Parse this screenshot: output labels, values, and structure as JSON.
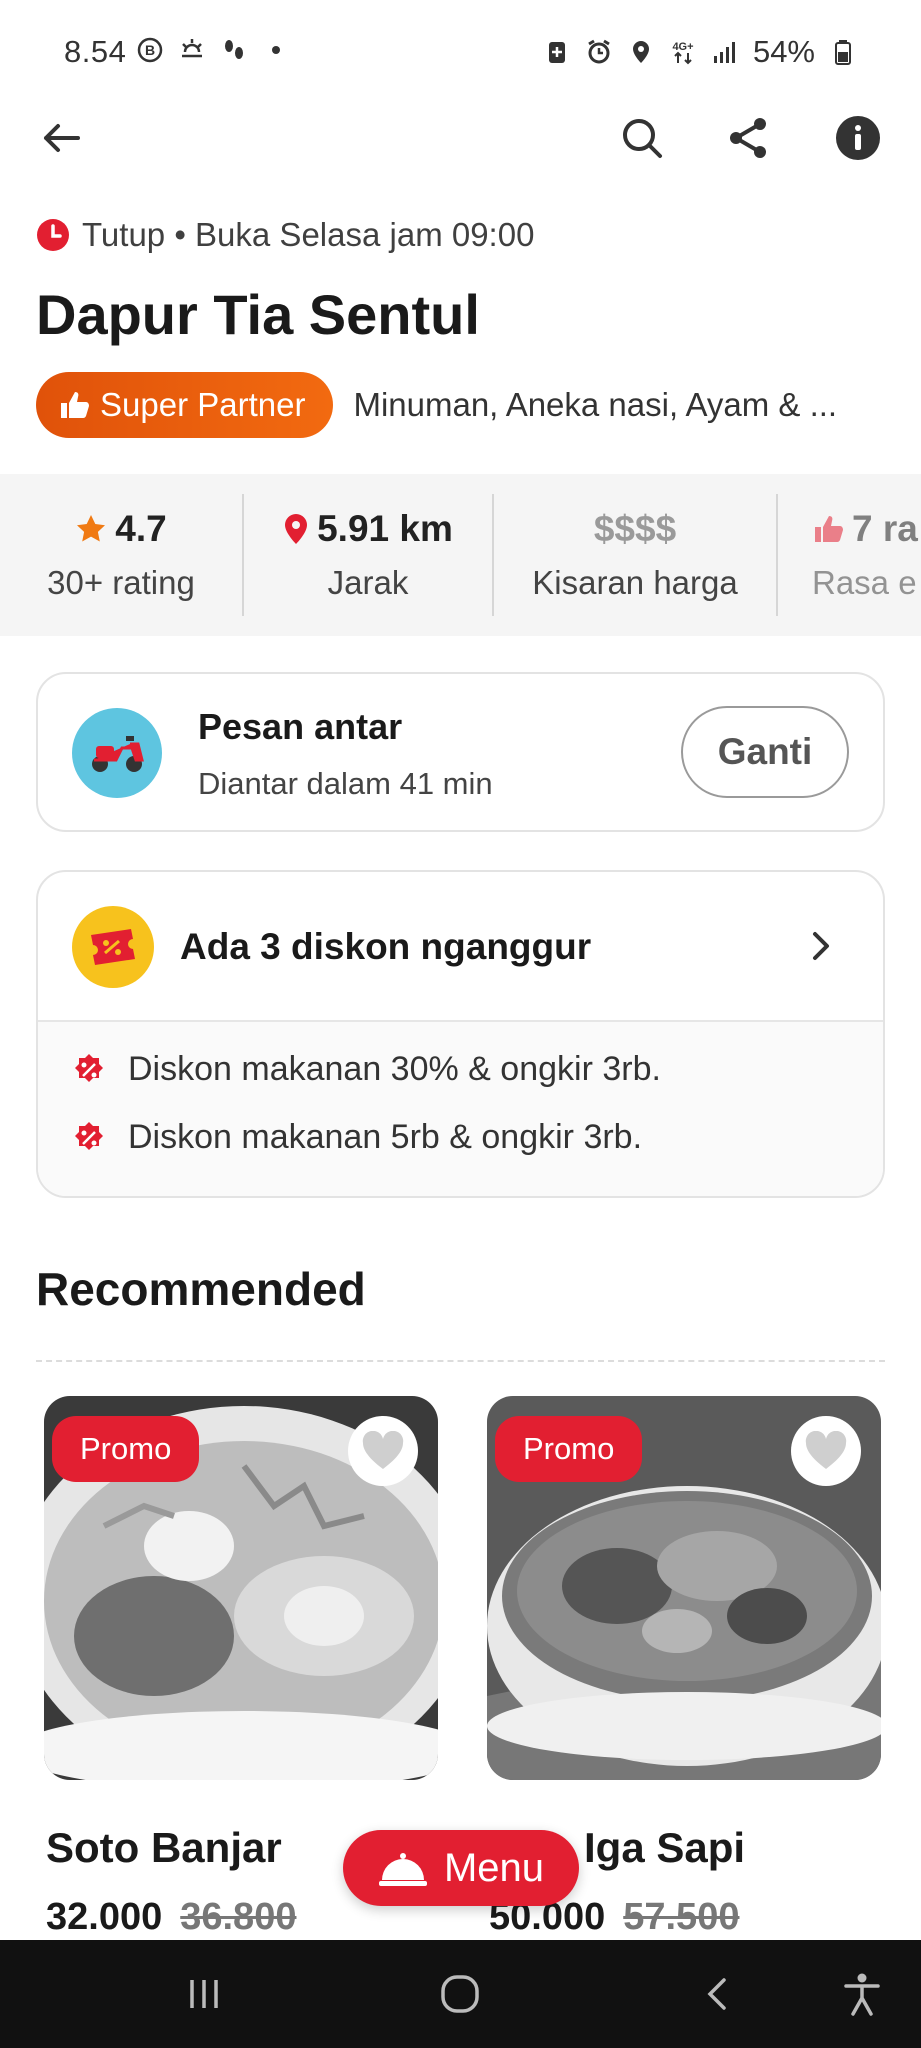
{
  "status_bar": {
    "time": "8.54",
    "battery": "54%",
    "icons": [
      "b-icon",
      "weather-icon",
      "steps-icon",
      "dot-icon",
      "battery-save-icon",
      "alarm-icon",
      "location-icon",
      "4g-icon",
      "signal-icon",
      "battery-icon"
    ]
  },
  "app_bar": {
    "icons": [
      "back-arrow-icon",
      "search-icon",
      "share-icon",
      "info-icon"
    ]
  },
  "restaurant": {
    "status": "Tutup • Buka Selasa jam 09:00",
    "name": "Dapur Tia Sentul",
    "badge": "Super Partner",
    "cuisine": "Minuman, Aneka nasi, Ayam & ..."
  },
  "stats": [
    {
      "value": "4.7",
      "label": "30+ rating",
      "icon": "star-icon"
    },
    {
      "value": "5.91 km",
      "label": "Jarak",
      "icon": "location-pin-icon"
    },
    {
      "value": "$$$$",
      "label": "Kisaran harga"
    },
    {
      "value": "7 ra",
      "label": "Rasa e",
      "icon": "thumbs-up-icon"
    }
  ],
  "delivery": {
    "title": "Pesan antar",
    "subtitle": "Diantar dalam 41 min",
    "button": "Ganti"
  },
  "discounts": {
    "title": "Ada 3 diskon nganggur",
    "items": [
      "Diskon makanan 30% & ongkir 3rb.",
      "Diskon makanan 5rb & ongkir 3rb."
    ]
  },
  "recommended": {
    "title": "Recommended",
    "items": [
      {
        "badge": "Promo",
        "name": "Soto Banjar",
        "price": "32.000",
        "old_price": "36.800"
      },
      {
        "badge": "Promo",
        "name": "Iga Sapi",
        "price": "50.000",
        "old_price": "57.500"
      }
    ]
  },
  "menu_button": "Menu",
  "colors": {
    "brand_red": "#e21f31",
    "partner_orange": "#e0520a",
    "star_orange": "#f07a13"
  }
}
